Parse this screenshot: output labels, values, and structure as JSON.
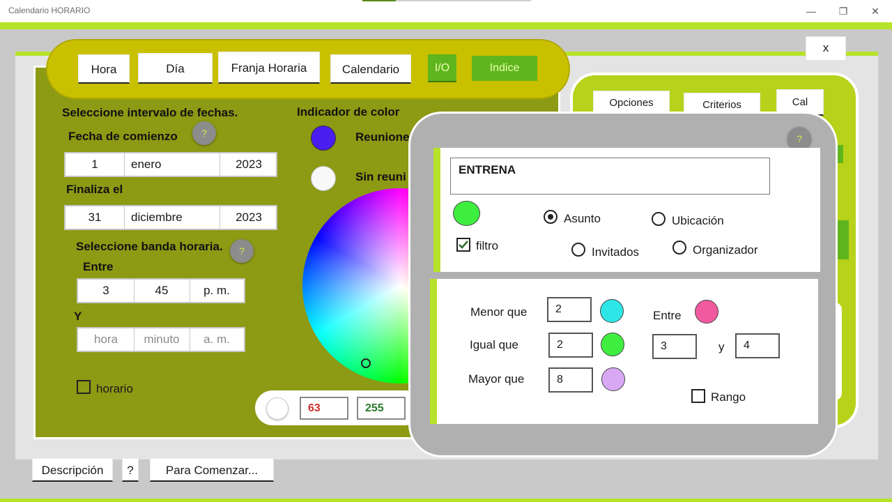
{
  "window": {
    "title": "Calendario HORARIO",
    "close_x": "x"
  },
  "top_tabs": [
    "Hora",
    "Día",
    "Franja Horaria",
    "Calendario",
    "I/O",
    "Indice"
  ],
  "left": {
    "range_title": "Seleccione intervalo de fechas.",
    "start_label": "Fecha de comienzo",
    "start": {
      "day": "1",
      "month": "enero",
      "year": "2023"
    },
    "end_label": "Finaliza el",
    "end": {
      "day": "31",
      "month": "diciembre",
      "year": "2023"
    },
    "band_title": "Seleccione banda horaria.",
    "between": "Entre",
    "between_time": {
      "hour": "3",
      "minute": "45",
      "ampm": "p. m."
    },
    "and": "Y",
    "and_time_placeholder": {
      "hour": "hora",
      "minute": "minuto",
      "ampm": "a. m."
    },
    "horario": "horario",
    "help": "?"
  },
  "color": {
    "title": "Indicador de color",
    "meetings": "Reunione",
    "no_meetings": "Sin reuni",
    "rgb_r": "63",
    "rgb_g": "255",
    "meetings_color": "#4a1df0"
  },
  "right": {
    "tabs": [
      "Opciones",
      "Criterios",
      "Cal"
    ]
  },
  "popup": {
    "help": "?",
    "text": "ENTRENA",
    "filter_label": "filtro",
    "filter_checked": true,
    "radios": {
      "asunto": "Asunto",
      "ubicacion": "Ubicación",
      "invitados": "Invitados",
      "organizador": "Organizador"
    },
    "selected": "Asunto",
    "less": {
      "label": "Menor que",
      "value": "2",
      "color": "#2ee6e6"
    },
    "equal": {
      "label": "Igual que",
      "value": "2",
      "color": "#3fef3f"
    },
    "greater": {
      "label": "Mayor que",
      "value": "8",
      "color": "#d8a8f4"
    },
    "between": {
      "label": "Entre",
      "from": "3",
      "y": "y",
      "to": "4",
      "color": "#f25aa0"
    },
    "rango": "Rango"
  },
  "bottom": {
    "descripcion": "Descripción",
    "help": "?",
    "comenzar": "Para Comenzar..."
  }
}
